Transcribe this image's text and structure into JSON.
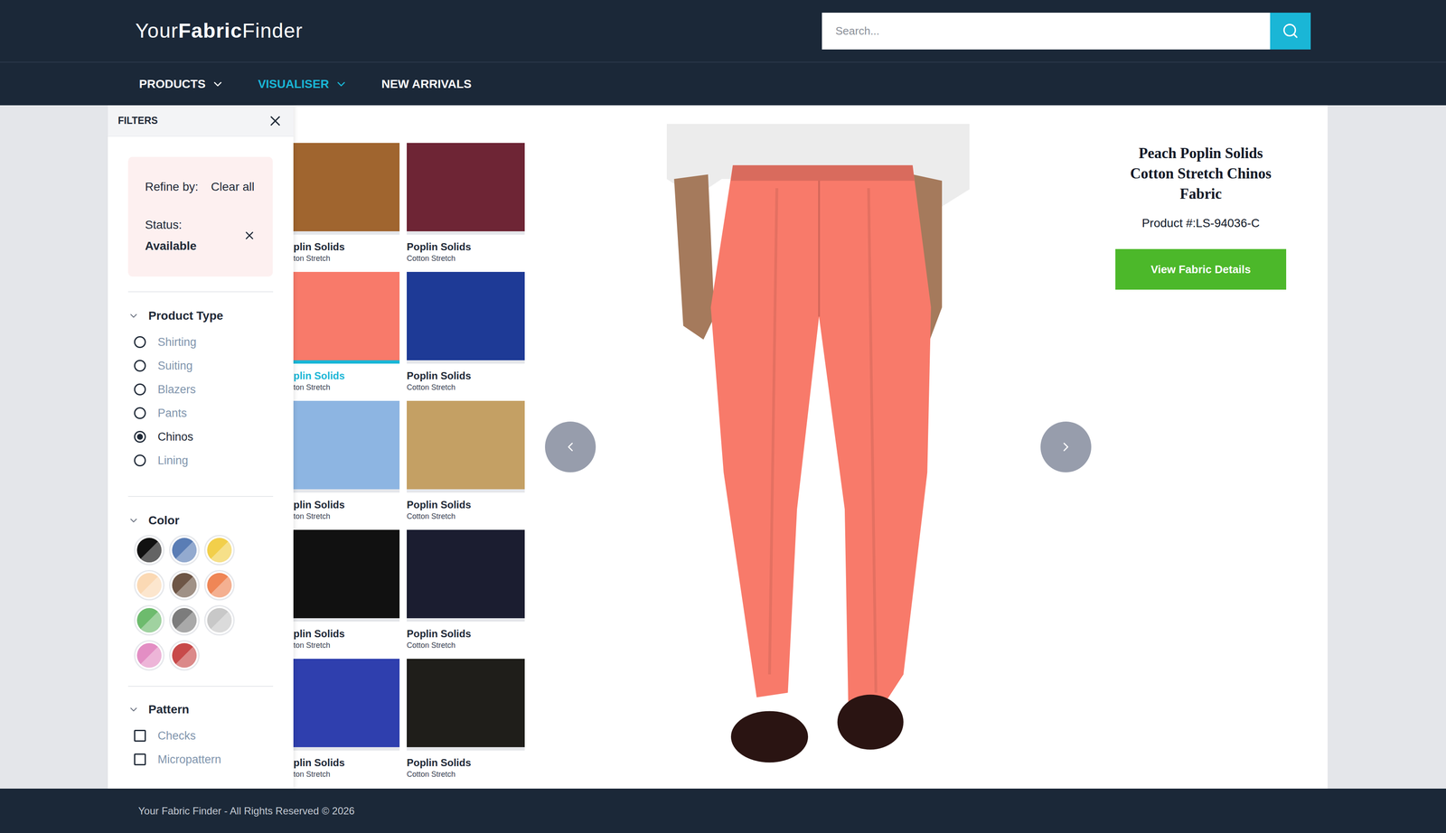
{
  "header": {
    "logo": [
      {
        "text": "Your",
        "bold": false
      },
      {
        "text": "Fabric",
        "bold": true
      },
      {
        "text": "Finder",
        "bold": false
      }
    ],
    "search": {
      "placeholder": "Search..."
    }
  },
  "nav": [
    {
      "label": "PRODUCTS",
      "selected": false
    },
    {
      "label": "VISUALISER",
      "selected": true
    },
    {
      "label": "NEW ARRIVALS",
      "selected": false
    }
  ],
  "filters": {
    "title": "FILTERS",
    "refine": {
      "label": "Refine by:",
      "clear": "Clear all",
      "chips": [
        {
          "name": "Status:",
          "value": "Available"
        }
      ]
    },
    "product_type": {
      "title": "Product Type",
      "expanded": true,
      "options": [
        {
          "label": "Shirting",
          "selected": false
        },
        {
          "label": "Suiting",
          "selected": false
        },
        {
          "label": "Blazers",
          "selected": false
        },
        {
          "label": "Pants",
          "selected": false
        },
        {
          "label": "Chinos",
          "selected": true
        },
        {
          "label": "Lining",
          "selected": false
        }
      ]
    },
    "color": {
      "title": "Color",
      "expanded": true,
      "swatches": [
        {
          "color": "#111111"
        },
        {
          "color": "#5a7db5"
        },
        {
          "color": "#f2cf4a"
        },
        {
          "color": "#fbd9b4"
        },
        {
          "color": "#6e5646"
        },
        {
          "color": "#ef8656"
        },
        {
          "color": "#6dbb6d"
        },
        {
          "color": "#7c7c7c"
        },
        {
          "color": "#c8c8c8"
        },
        {
          "color": "#e38ec4"
        },
        {
          "color": "#c84a4a"
        }
      ]
    },
    "pattern": {
      "title": "Pattern",
      "expanded": true,
      "options": [
        {
          "label": "Checks",
          "checked": false
        },
        {
          "label": "Micropattern",
          "checked": false
        }
      ]
    }
  },
  "swatches": [
    {
      "title": "plin Solids",
      "subtitle": "ton Stretch",
      "color": "#a0652f",
      "selected": false
    },
    {
      "title": "Poplin Solids",
      "subtitle": "Cotton Stretch",
      "color": "#6e2535",
      "selected": false
    },
    {
      "title": "plin Solids",
      "subtitle": "ton Stretch",
      "color": "#f87a6a",
      "selected": true
    },
    {
      "title": "Poplin Solids",
      "subtitle": "Cotton Stretch",
      "color": "#1e3a96",
      "selected": false
    },
    {
      "title": "plin Solids",
      "subtitle": "ton Stretch",
      "color": "#8db5e2",
      "selected": false
    },
    {
      "title": "Poplin Solids",
      "subtitle": "Cotton Stretch",
      "color": "#c4a064",
      "selected": false
    },
    {
      "title": "plin Solids",
      "subtitle": "ton Stretch",
      "color": "#111111",
      "selected": false
    },
    {
      "title": "Poplin Solids",
      "subtitle": "Cotton Stretch",
      "color": "#1b1d30",
      "selected": false
    },
    {
      "title": "plin Solids",
      "subtitle": "ton Stretch",
      "color": "#2f3fae",
      "selected": false
    },
    {
      "title": "Poplin Solids",
      "subtitle": "Cotton Stretch",
      "color": "#1f1e1a",
      "selected": false
    }
  ],
  "product": {
    "title": "Peach Poplin Solids Cotton Stretch Chinos Fabric",
    "number": "Product #:LS-94036-C",
    "button": "View Fabric Details"
  },
  "footer": {
    "text": "Your Fabric Finder - All Rights Reserved © 2026"
  }
}
